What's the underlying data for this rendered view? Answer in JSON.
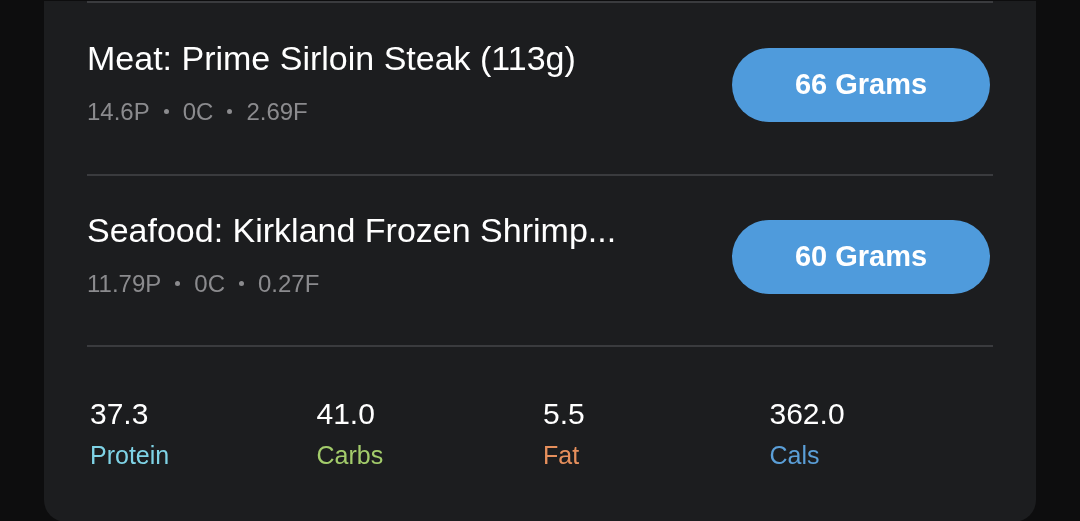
{
  "foods": [
    {
      "name": "Meat: Prime Sirloin Steak (113g)",
      "macros": [
        "14.6P",
        "0C",
        "2.69F"
      ],
      "amount": "66 Grams"
    },
    {
      "name": "Seafood: Kirkland Frozen Shrimp...",
      "macros": [
        "11.79P",
        "0C",
        "0.27F"
      ],
      "amount": "60 Grams"
    }
  ],
  "totals": [
    {
      "value": "37.3",
      "label": "Protein",
      "color": "#7fd3e6"
    },
    {
      "value": "41.0",
      "label": "Carbs",
      "color": "#a3cc6b"
    },
    {
      "value": "5.5",
      "label": "Fat",
      "color": "#e68f5c"
    },
    {
      "value": "362.0",
      "label": "Cals",
      "color": "#5b9fd8"
    }
  ]
}
